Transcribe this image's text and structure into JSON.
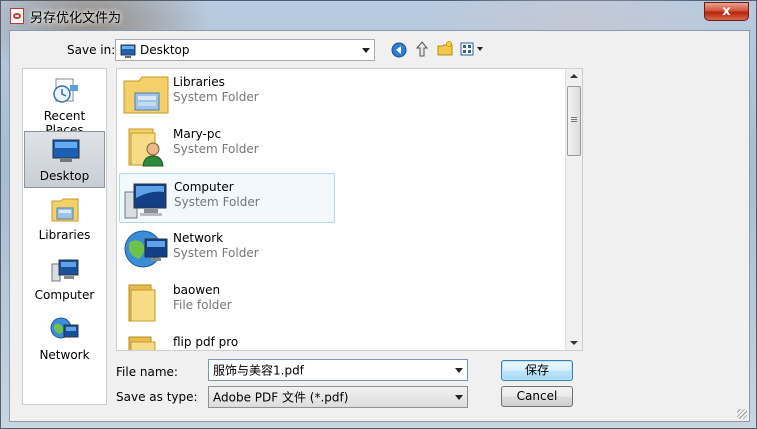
{
  "window": {
    "title": "另存优化文件为",
    "close_glyph": "x"
  },
  "toolbar": {
    "save_in_label": "Save in:",
    "save_in_value": "Desktop"
  },
  "places": [
    {
      "label": "Recent Places",
      "icon": "recent-places-icon"
    },
    {
      "label": "Desktop",
      "icon": "desktop-icon",
      "selected": true
    },
    {
      "label": "Libraries",
      "icon": "libraries-icon"
    },
    {
      "label": "Computer",
      "icon": "computer-icon"
    },
    {
      "label": "Network",
      "icon": "network-icon"
    }
  ],
  "files": [
    {
      "name": "Libraries",
      "type": "System Folder",
      "icon": "libraries-folder-icon"
    },
    {
      "name": "Mary-pc",
      "type": "System Folder",
      "icon": "user-folder-icon"
    },
    {
      "name": "Computer",
      "type": "System Folder",
      "icon": "computer-icon"
    },
    {
      "name": "Network",
      "type": "System Folder",
      "icon": "network-globe-icon"
    },
    {
      "name": "baowen",
      "type": "File folder",
      "icon": "folder-icon"
    },
    {
      "name": "flip pdf pro",
      "type": "",
      "icon": "folder-icon"
    }
  ],
  "form": {
    "file_name_label": "File name:",
    "file_name_value": "服饰与美容1.pdf",
    "save_as_type_label": "Save as type:",
    "save_as_type_value": "Adobe PDF 文件 (*.pdf)"
  },
  "buttons": {
    "save": "保存",
    "cancel": "Cancel"
  },
  "colors": {
    "accent_close": "#c8391c",
    "default_button_border": "#3c7fb1",
    "hover_border": "#b8d6ee"
  }
}
